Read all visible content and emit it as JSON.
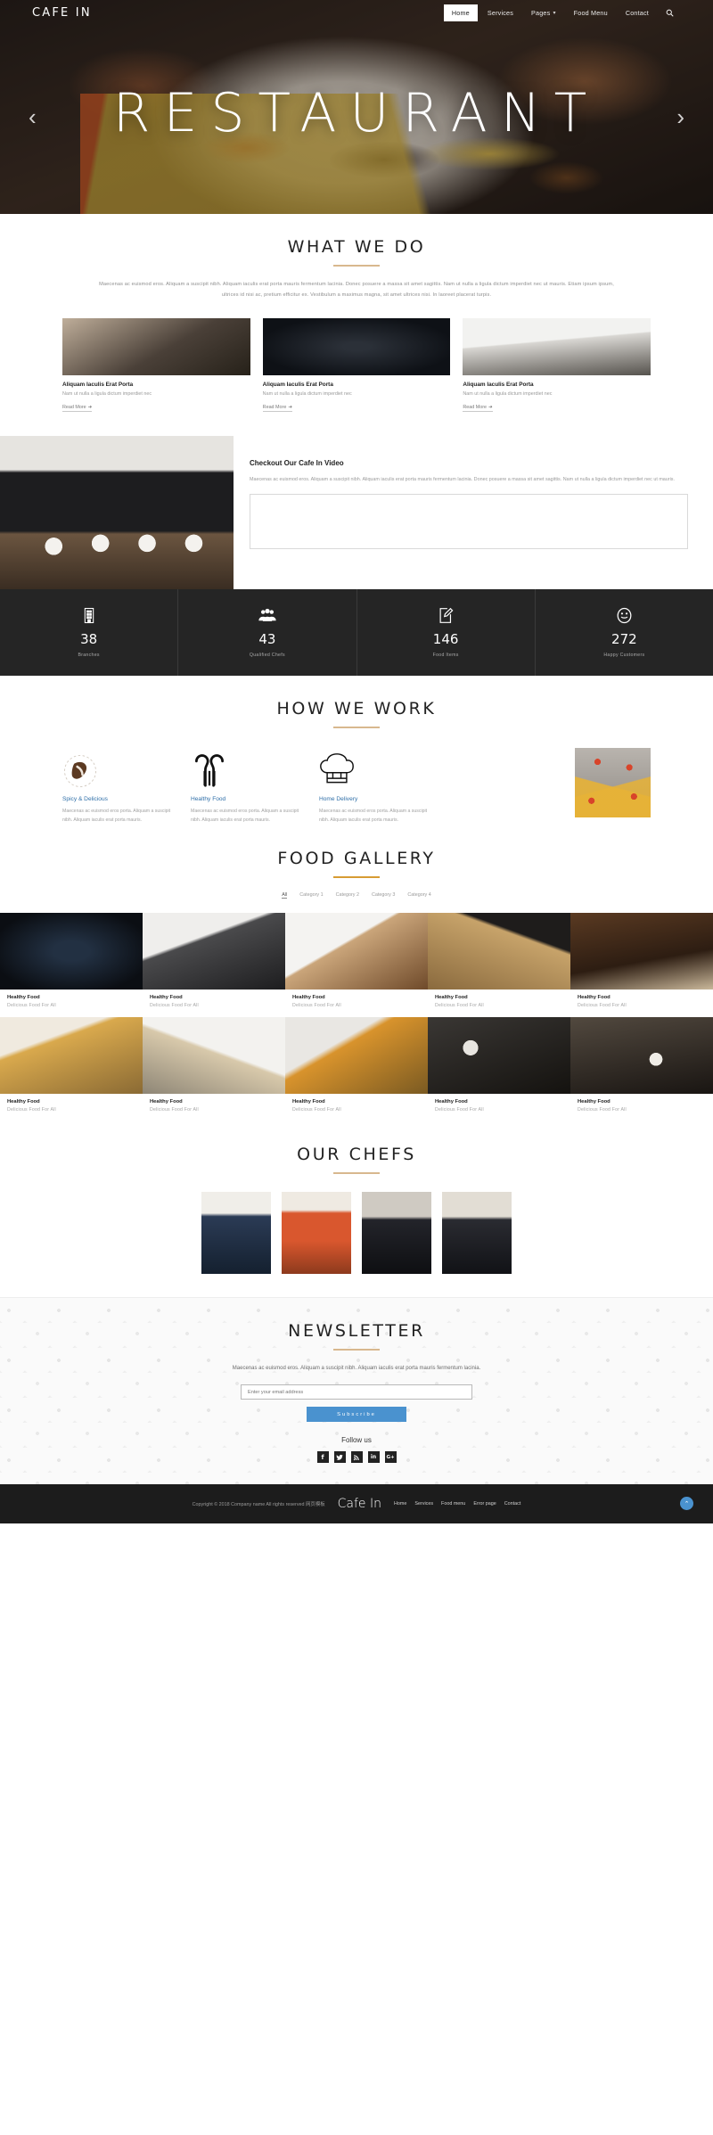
{
  "nav": {
    "brand": "CAFE IN",
    "links": [
      {
        "label": "Home",
        "active": true
      },
      {
        "label": "Services",
        "active": false
      },
      {
        "label": "Pages",
        "active": false,
        "caret": "▾"
      },
      {
        "label": "Food Menu",
        "active": false
      },
      {
        "label": "Contact",
        "active": false
      }
    ],
    "search_icon": "search-icon"
  },
  "hero": {
    "title": "RESTAURANT",
    "prev": "‹",
    "next": "›"
  },
  "what_we_do": {
    "title": "WHAT WE DO",
    "lead": "Maecenas ac euismod eros. Aliquam a suscipit nibh. Aliquam iaculis erat porta mauris fermentum lacinia. Donec posuere a massa sit amet sagittis. Nam ut nulla a ligula dictum imperdiet nec ut mauris. Etiam ipsum ipsum, ultrices id nisi ac, pretium efficitur ex. Vestibulum a maximus magna, sit amet ultrices nisi. In laoreet placerat turpis.",
    "cards": [
      {
        "title": "Aliquam Iaculis Erat Porta",
        "desc": "Nam ut nulla a ligula dictum imperdiet nec",
        "link": "Read More",
        "arrow": "➜"
      },
      {
        "title": "Aliquam Iaculis Erat Porta",
        "desc": "Nam ut nulla a ligula dictum imperdiet nec",
        "link": "Read More",
        "arrow": "➜"
      },
      {
        "title": "Aliquam Iaculis Erat Porta",
        "desc": "Nam ut nulla a ligula dictum imperdiet nec",
        "link": "Read More",
        "arrow": "➜"
      }
    ]
  },
  "video": {
    "heading": "Checkout Our Cafe In Video",
    "paragraph": "Maecenas ac euismod eros. Aliquam a suscipit nibh. Aliquam iaculis erat porta mauris fermentum lacinia. Donec posuere a massa sit amet sagittis. Nam ut nulla a ligula dictum imperdiet nec ut mauris."
  },
  "stats": [
    {
      "icon": "building-icon",
      "value": "38",
      "label": "Branches"
    },
    {
      "icon": "people-icon",
      "value": "43",
      "label": "Qualified Chefs"
    },
    {
      "icon": "edit-note-icon",
      "value": "146",
      "label": "Food Items"
    },
    {
      "icon": "smiley-face-icon",
      "value": "272",
      "label": "Happy Customers"
    }
  ],
  "how_we_work": {
    "title": "HOW WE WORK",
    "items": [
      {
        "icon": "chili-pepper-icon",
        "title": "Spicy & Delicious",
        "desc": "Maecenas ac euismod eros porta. Aliquam a suscipit nibh. Aliquam iaculis erat porta mauris."
      },
      {
        "icon": "cutlery-icon",
        "title": "Healthy Food",
        "desc": "Maecenas ac euismod eros porta. Aliquam a suscipit nibh. Aliquam iaculis erat porta mauris."
      },
      {
        "icon": "chef-hat-icon",
        "title": "Home Delivery",
        "desc": "Maecenas ac euismod eros porta. Aliquam a suscipit nibh. Aliquam iaculis erat porta mauris."
      }
    ]
  },
  "gallery": {
    "title": "FOOD GALLERY",
    "filters": [
      {
        "label": "All",
        "active": true
      },
      {
        "label": "Category 1",
        "active": false
      },
      {
        "label": "Category 2",
        "active": false
      },
      {
        "label": "Category 3",
        "active": false
      },
      {
        "label": "Category 4",
        "active": false
      }
    ],
    "items": [
      {
        "title": "Healthy Food",
        "desc": "Delicious Food For All"
      },
      {
        "title": "Healthy Food",
        "desc": "Delicious Food For All"
      },
      {
        "title": "Healthy Food",
        "desc": "Delicious Food For All"
      },
      {
        "title": "Healthy Food",
        "desc": "Delicious Food For All"
      },
      {
        "title": "Healthy Food",
        "desc": "Delicious Food For All"
      },
      {
        "title": "Healthy Food",
        "desc": "Delicious Food For All"
      },
      {
        "title": "Healthy Food",
        "desc": "Delicious Food For All"
      },
      {
        "title": "Healthy Food",
        "desc": "Delicious Food For All"
      },
      {
        "title": "Healthy Food",
        "desc": "Delicious Food For All"
      },
      {
        "title": "Healthy Food",
        "desc": "Delicious Food For All"
      }
    ]
  },
  "chefs": {
    "title": "OUR CHEFS"
  },
  "newsletter": {
    "title": "NEWSLETTER",
    "paragraph": "Maecenas ac euismod eros. Aliquam a suscipit nibh. Aliquam iaculis erat porta mauris fermentum lacinia.",
    "placeholder": "Enter your email address",
    "button": "Subscribe",
    "follow": "Follow us",
    "socials": [
      {
        "name": "facebook-icon",
        "glyph": "f"
      },
      {
        "name": "twitter-icon",
        "glyph": "🐦"
      },
      {
        "name": "rss-icon",
        "glyph": "❋"
      },
      {
        "name": "linkedin-icon",
        "glyph": "in"
      },
      {
        "name": "google-plus-icon",
        "glyph": "G+"
      }
    ]
  },
  "footer": {
    "copyright": "Copyright © 2018 Company name All rights reserved 网页模板",
    "brand": "Cafe In",
    "links": [
      "Home",
      "Services",
      "Food menu",
      "Error page",
      "Contact"
    ],
    "to_top": "⌃"
  },
  "colors": {
    "accent_gold": "#d79b33",
    "rule_tan": "#d8b88e",
    "link_blue": "#2f6fa8",
    "button_blue": "#4a92cf",
    "dark": "#252525"
  }
}
